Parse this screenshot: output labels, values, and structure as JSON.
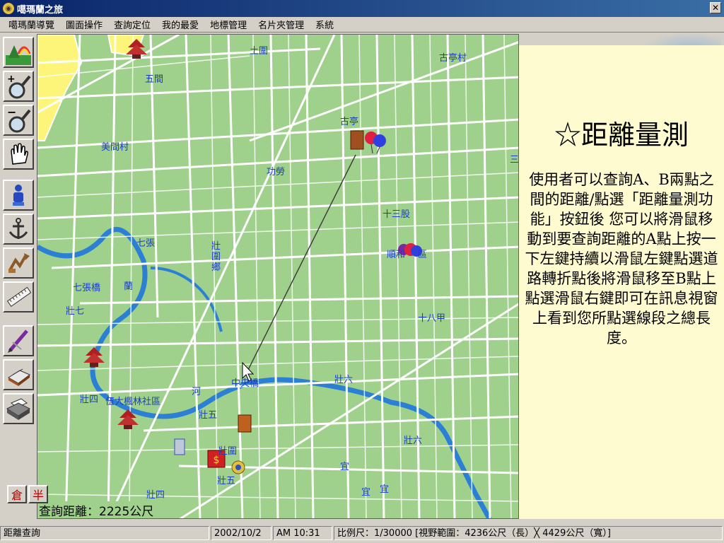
{
  "window": {
    "title": "噶瑪蘭之旅",
    "app_icon": "eye-icon",
    "close_label": "✕"
  },
  "menu": [
    "噶瑪蘭導覽",
    "圖面操作",
    "查詢定位",
    "我的最愛",
    "地標管理",
    "名片夾管理",
    "系統"
  ],
  "tools": [
    "home-landscape-icon",
    "zoom-in-icon",
    "zoom-out-icon",
    "pan-hand-icon",
    "person-icon",
    "anchor-icon",
    "locate-icon",
    "ruler-icon",
    "pen-icon",
    "card-file-icon",
    "printer-icon"
  ],
  "map": {
    "labels": [
      "土圍",
      "古亭村",
      "五間",
      "美間村",
      "古亭",
      "功勞",
      "十三股",
      "七張",
      "壯圍鄉",
      "順和",
      "區",
      "七張橋",
      "蘭",
      "壯七",
      "十八甲",
      "中央橋",
      "壯六",
      "壯四",
      "伍大楓林社區",
      "河",
      "壯五",
      "壯六",
      "宜",
      "宜",
      "宜",
      "壯四",
      "壯五",
      "壯圍",
      "三"
    ],
    "measure_text": "查詢距離：2225公尺",
    "corner_buttons": [
      "倉",
      "半"
    ],
    "colors": {
      "land": "#9fd08c",
      "road": "#ffffff",
      "river": "#2b7fd4",
      "urban": "#fdf57a",
      "measure_line": "#404040"
    }
  },
  "panel": {
    "title": "☆距離量測",
    "description": "使用者可以查詢A、B兩點之間的距離/點選「距離量測功能」按鈕後 您可以將滑鼠移動到要查詢距離的A點上按一下左鍵持續以滑鼠左鍵點選道路轉折點後將滑鼠移至B點上點選滑鼠右鍵即可在訊息視窗上看到您所點選線段之總長度。"
  },
  "status": {
    "mode": "距離查詢",
    "date": "2002/10/2",
    "time": "AM 10:31",
    "scale": "比例尺：1/30000 [視野範圍：4236公尺（長）╳ 4429公尺（寬）]"
  }
}
